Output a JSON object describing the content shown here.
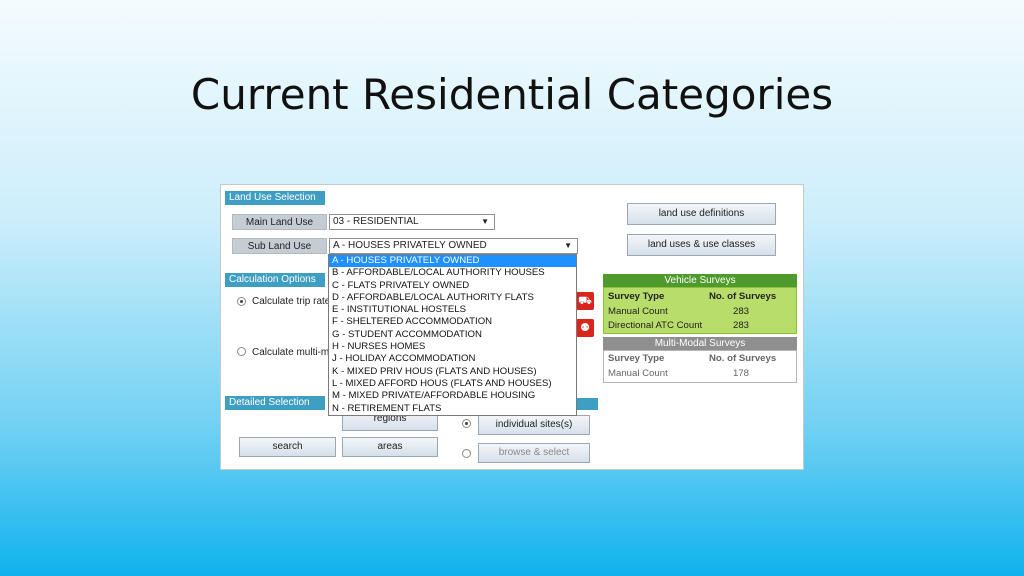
{
  "slide": {
    "title": "Current Residential Categories"
  },
  "land_use_selection": {
    "header": "Land Use Selection",
    "main_land_use_label": "Main Land Use",
    "main_land_use_value": "03 - RESIDENTIAL",
    "sub_land_use_label": "Sub Land Use",
    "sub_land_use_value": "A - HOUSES PRIVATELY OWNED",
    "dropdown_arrow": "▼"
  },
  "sub_land_use_options": [
    "A - HOUSES PRIVATELY OWNED",
    "B - AFFORDABLE/LOCAL AUTHORITY HOUSES",
    "C - FLATS PRIVATELY OWNED",
    "D - AFFORDABLE/LOCAL AUTHORITY FLATS",
    "E - INSTITUTIONAL HOSTELS",
    "F - SHELTERED ACCOMMODATION",
    "G - STUDENT ACCOMMODATION",
    "H - NURSES HOMES",
    "J - HOLIDAY ACCOMMODATION",
    "K - MIXED PRIV HOUS (FLATS AND HOUSES)",
    "L - MIXED AFFORD HOUS (FLATS AND HOUSES)",
    "M - MIXED PRIVATE/AFFORDABLE HOUSING",
    "N - RETIREMENT FLATS"
  ],
  "buttons": {
    "land_use_definitions": "land use definitions",
    "land_uses_classes": "land uses & use classes",
    "regions": "regions",
    "search": "search",
    "areas": "areas",
    "individual_sites": "individual sites(s)",
    "browse_select": "browse & select"
  },
  "calculation_options": {
    "header": "Calculation Options",
    "option1": "Calculate trip rate",
    "option2": "Calculate multi-m"
  },
  "detailed_selection": {
    "header": "Detailed Selection"
  },
  "vehicle_surveys": {
    "header": "Vehicle Surveys",
    "col1": "Survey Type",
    "col2": "No. of Surveys",
    "rows": [
      {
        "type": "Manual Count",
        "count": "283"
      },
      {
        "type": "Directional ATC Count",
        "count": "283"
      }
    ]
  },
  "multi_modal_surveys": {
    "header": "Multi-Modal Surveys",
    "col1": "Survey Type",
    "col2": "No. of Surveys",
    "rows": [
      {
        "type": "Manual Count",
        "count": "178"
      }
    ]
  },
  "colors": {
    "section_header": "#3f9fc2",
    "vehicle_header": "#4f9a2d",
    "vehicle_body": "#b8dd6a",
    "multi_modal_header": "#8f8f8f",
    "selected_option": "#1e90ff"
  }
}
